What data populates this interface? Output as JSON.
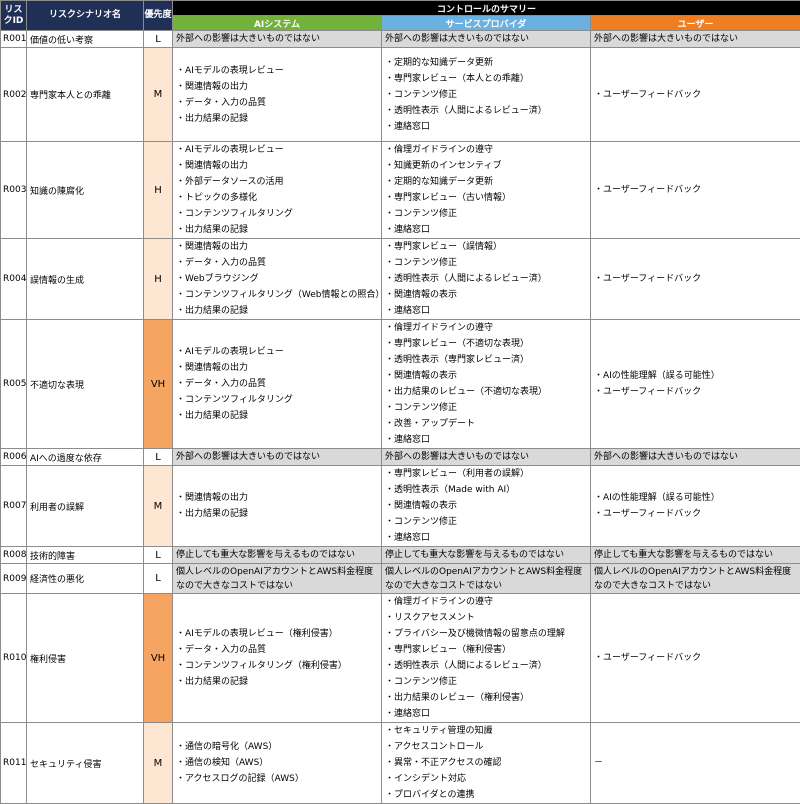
{
  "header": {
    "risk_id": "リスクID",
    "scenario": "リスクシナリオ名",
    "priority": "優先度",
    "summary": "コントロールのサマリー",
    "ai_system": "AIシステム",
    "service_provider": "サービスプロバイダ",
    "user": "ユーザー"
  },
  "colors": {
    "header_bg": "#1f2f55",
    "ai_header": "#73b23a",
    "sp_header": "#6ab0e0",
    "user_header": "#ef7d22",
    "priority_M_H": "#fde7d3",
    "priority_VH": "#f6a461",
    "gray_cell": "#d9d9d9"
  },
  "rows": [
    {
      "id": "R001",
      "name": "価値の低い考察",
      "priority": "L",
      "gray": true,
      "ai": [
        "外部への影響は大きいものではない"
      ],
      "sp": [
        "外部への影響は大きいものではない"
      ],
      "user": [
        "外部への影響は大きいものではない"
      ]
    },
    {
      "id": "R002",
      "name": "専門家本人との乖離",
      "priority": "M",
      "gray": false,
      "ai": [
        "・AIモデルの表現レビュー",
        "・関連情報の出力",
        "・データ・入力の品質",
        "・出力結果の記録"
      ],
      "sp": [
        "・定期的な知識データ更新",
        "・専門家レビュー（本人との乖離）",
        "・コンテンツ修正",
        "・透明性表示（人間によるレビュー済）",
        "・連絡窓口"
      ],
      "user": [
        "・ユーザーフィードバック"
      ]
    },
    {
      "id": "R003",
      "name": "知識の陳腐化",
      "priority": "H",
      "gray": false,
      "ai": [
        "・AIモデルの表現レビュー",
        "・関連情報の出力",
        "・外部データソースの活用",
        "・トピックの多様化",
        "・コンテンツフィルタリング",
        "・出力結果の記録"
      ],
      "sp": [
        "・倫理ガイドラインの遵守",
        "・知識更新のインセンティブ",
        "・定期的な知識データ更新",
        "・専門家レビュー（古い情報）",
        "・コンテンツ修正",
        "・連絡窓口"
      ],
      "user": [
        "・ユーザーフィードバック"
      ]
    },
    {
      "id": "R004",
      "name": "誤情報の生成",
      "priority": "H",
      "gray": false,
      "ai": [
        "・関連情報の出力",
        "・データ・入力の品質",
        "・Webブラウジング",
        "・コンテンツフィルタリング（Web情報との照合）",
        "・出力結果の記録"
      ],
      "sp": [
        "・専門家レビュー（誤情報）",
        "・コンテンツ修正",
        "・透明性表示（人間によるレビュー済）",
        "・関連情報の表示",
        "・連絡窓口"
      ],
      "user": [
        "・ユーザーフィードバック"
      ]
    },
    {
      "id": "R005",
      "name": "不適切な表現",
      "priority": "VH",
      "gray": false,
      "ai": [
        "・AIモデルの表現レビュー",
        "・関連情報の出力",
        "・データ・入力の品質",
        "・コンテンツフィルタリング",
        "・出力結果の記録"
      ],
      "sp": [
        "・倫理ガイドラインの遵守",
        "・専門家レビュー（不適切な表現）",
        "・透明性表示（専門家レビュー済）",
        "・関連情報の表示",
        "・出力結果のレビュー（不適切な表現）",
        "・コンテンツ修正",
        "・改善・アップデート",
        "・連絡窓口"
      ],
      "user": [
        "・AIの性能理解（誤る可能性）",
        "・ユーザーフィードバック"
      ]
    },
    {
      "id": "R006",
      "name": "AIへの過度な依存",
      "priority": "L",
      "gray": true,
      "ai": [
        "外部への影響は大きいものではない"
      ],
      "sp": [
        "外部への影響は大きいものではない"
      ],
      "user": [
        "外部への影響は大きいものではない"
      ]
    },
    {
      "id": "R007",
      "name": "利用者の誤解",
      "priority": "M",
      "gray": false,
      "ai": [
        "・関連情報の出力",
        "・出力結果の記録"
      ],
      "sp": [
        "・専門家レビュー（利用者の誤解）",
        "・透明性表示（Made with AI）",
        "・関連情報の表示",
        "・コンテンツ修正",
        "・連絡窓口"
      ],
      "user": [
        "・AIの性能理解（誤る可能性）",
        "・ユーザーフィードバック"
      ]
    },
    {
      "id": "R008",
      "name": "技術的障害",
      "priority": "L",
      "gray": true,
      "ai": [
        "停止しても重大な影響を与えるものではない"
      ],
      "sp": [
        "停止しても重大な影響を与えるものではない"
      ],
      "user": [
        "停止しても重大な影響を与えるものではない"
      ]
    },
    {
      "id": "R009",
      "name": "経済性の悪化",
      "priority": "L",
      "gray": true,
      "ai": [
        "個人レベルのOpenAIアカウントとAWS料金程度なので大きなコストではない"
      ],
      "sp": [
        "個人レベルのOpenAIアカウントとAWS料金程度なので大きなコストではない"
      ],
      "user": [
        "個人レベルのOpenAIアカウントとAWS料金程度なので大きなコストではない"
      ]
    },
    {
      "id": "R010",
      "name": "権利侵害",
      "priority": "VH",
      "gray": false,
      "ai": [
        "・AIモデルの表現レビュー（権利侵害）",
        "・データ・入力の品質",
        "・コンテンツフィルタリング（権利侵害）",
        "・出力結果の記録"
      ],
      "sp": [
        "・倫理ガイドラインの遵守",
        "・リスクアセスメント",
        "・プライバシー及び機微情報の留意点の理解",
        "・専門家レビュー（権利侵害）",
        "・透明性表示（人間によるレビュー済）",
        "・コンテンツ修正",
        "・出力結果のレビュー（権利侵害）",
        "・連絡窓口"
      ],
      "user": [
        "・ユーザーフィードバック"
      ]
    },
    {
      "id": "R011",
      "name": "セキュリティ侵害",
      "priority": "M",
      "gray": false,
      "ai": [
        "・通信の暗号化（AWS）",
        "・通信の検知（AWS）",
        "・アクセスログの記録（AWS）"
      ],
      "sp": [
        "・セキュリティ管理の知識",
        "・アクセスコントロール",
        "・異常・不正アクセスの確認",
        "・インシデント対応",
        "・プロバイダとの連携"
      ],
      "user": [
        "－"
      ]
    }
  ]
}
